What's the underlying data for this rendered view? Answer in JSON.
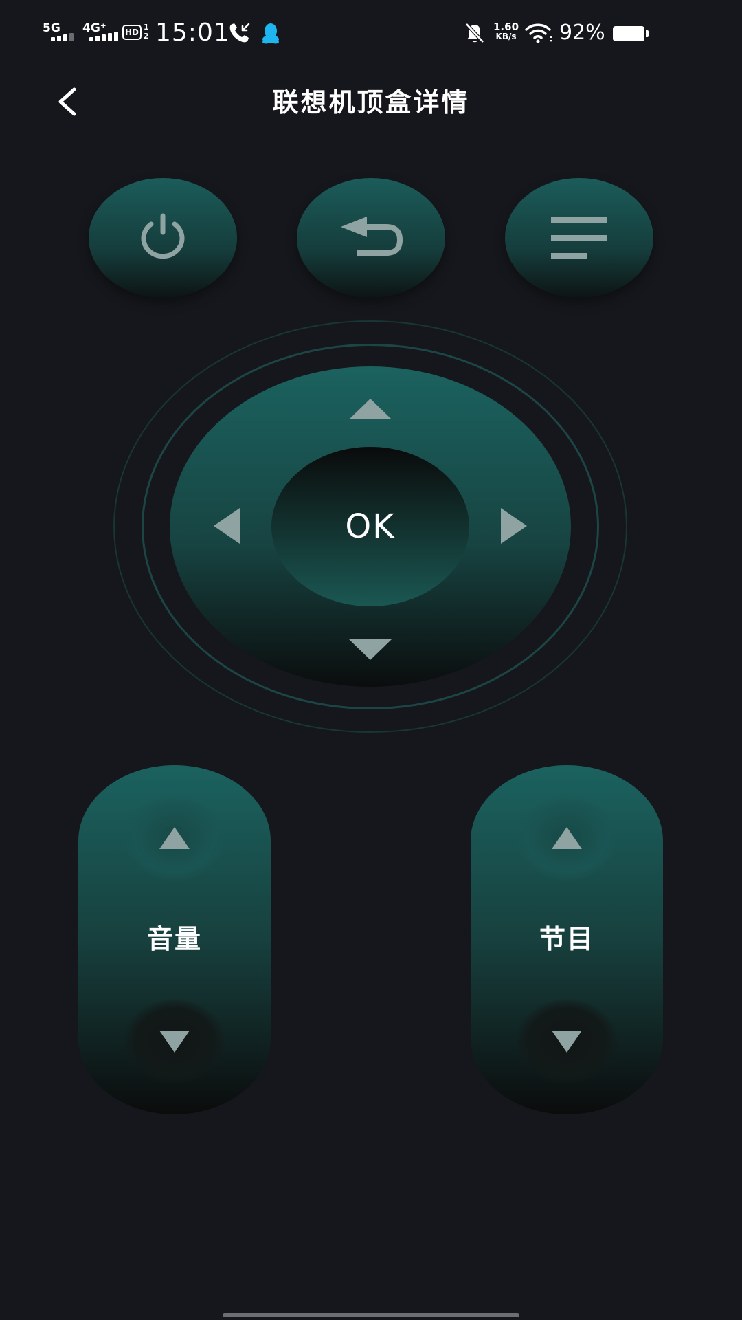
{
  "status_bar": {
    "network_1": "5G",
    "network_2": "4G⁺",
    "hd_badge": "HD",
    "hd_sub": "1\n2",
    "time": "15:01",
    "net_speed_value": "1.60",
    "net_speed_unit": "KB/s",
    "battery": "92%",
    "icons": [
      "phone-call-icon",
      "qq-penguin-icon",
      "bell-muted-icon",
      "wifi-icon",
      "battery-icon"
    ],
    "qq_color": "#1fb6f0"
  },
  "header": {
    "title": "联想机顶盒详情",
    "back_icon": "chevron-left-icon"
  },
  "top_buttons": [
    {
      "name": "power",
      "icon": "power-icon"
    },
    {
      "name": "back",
      "icon": "return-arrow-icon"
    },
    {
      "name": "menu",
      "icon": "menu-lines-icon"
    }
  ],
  "dpad": {
    "ok_label": "OK",
    "icons": [
      "triangle-up-icon",
      "triangle-down-icon",
      "triangle-left-icon",
      "triangle-right-icon"
    ]
  },
  "volume": {
    "label": "音量"
  },
  "channel": {
    "label": "节目"
  },
  "colors": {
    "background": "#16171c",
    "button_teal": "#1b625f",
    "icon_gray": "#8fa3a2"
  }
}
